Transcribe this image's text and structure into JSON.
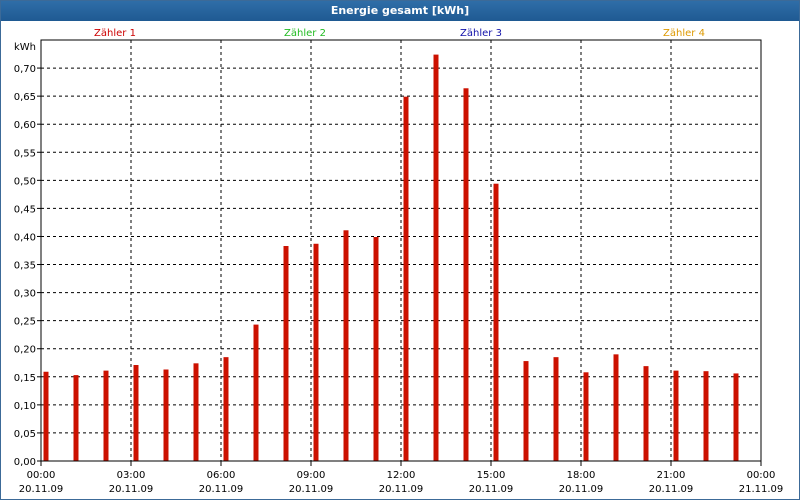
{
  "title": "Energie gesamt [kWh]",
  "legend": [
    {
      "label": "Zähler 1",
      "color": "#cc0000"
    },
    {
      "label": "Zähler 2",
      "color": "#22bb22"
    },
    {
      "label": "Zähler 3",
      "color": "#1111aa"
    },
    {
      "label": "Zähler 4",
      "color": "#dd9900"
    }
  ],
  "chart_data": {
    "type": "bar",
    "title": "Energie gesamt [kWh]",
    "ylabel": "kWh",
    "ylim": [
      0,
      0.75
    ],
    "yticks": [
      "0,00",
      "0,05",
      "0,10",
      "0,15",
      "0,20",
      "0,25",
      "0,30",
      "0,35",
      "0,40",
      "0,45",
      "0,50",
      "0,55",
      "0,60",
      "0,65",
      "0,70"
    ],
    "xlim": [
      "20.11.09 00:00",
      "21.11.09 00:00"
    ],
    "xticks": [
      {
        "time": "00:00",
        "date": "20.11.09"
      },
      {
        "time": "03:00",
        "date": "20.11.09"
      },
      {
        "time": "06:00",
        "date": "20.11.09"
      },
      {
        "time": "09:00",
        "date": "20.11.09"
      },
      {
        "time": "12:00",
        "date": "20.11.09"
      },
      {
        "time": "15:00",
        "date": "20.11.09"
      },
      {
        "time": "18:00",
        "date": "20.11.09"
      },
      {
        "time": "21:00",
        "date": "20.11.09"
      },
      {
        "time": "00:00",
        "date": "21.11.09"
      }
    ],
    "grid": true,
    "bar_color": "#cc1100",
    "x": [
      "00:00",
      "01:00",
      "02:00",
      "03:00",
      "04:00",
      "05:00",
      "06:00",
      "07:00",
      "08:00",
      "09:00",
      "10:00",
      "11:00",
      "12:00",
      "13:00",
      "14:00",
      "15:00",
      "16:00",
      "17:00",
      "18:00",
      "19:00",
      "20:00",
      "21:00",
      "22:00",
      "23:00"
    ],
    "values": [
      0.159,
      0.153,
      0.161,
      0.171,
      0.163,
      0.174,
      0.185,
      0.243,
      0.383,
      0.387,
      0.411,
      0.399,
      0.649,
      0.724,
      0.664,
      0.494,
      0.178,
      0.185,
      0.158,
      0.19,
      0.169,
      0.161,
      0.16,
      0.156
    ]
  }
}
